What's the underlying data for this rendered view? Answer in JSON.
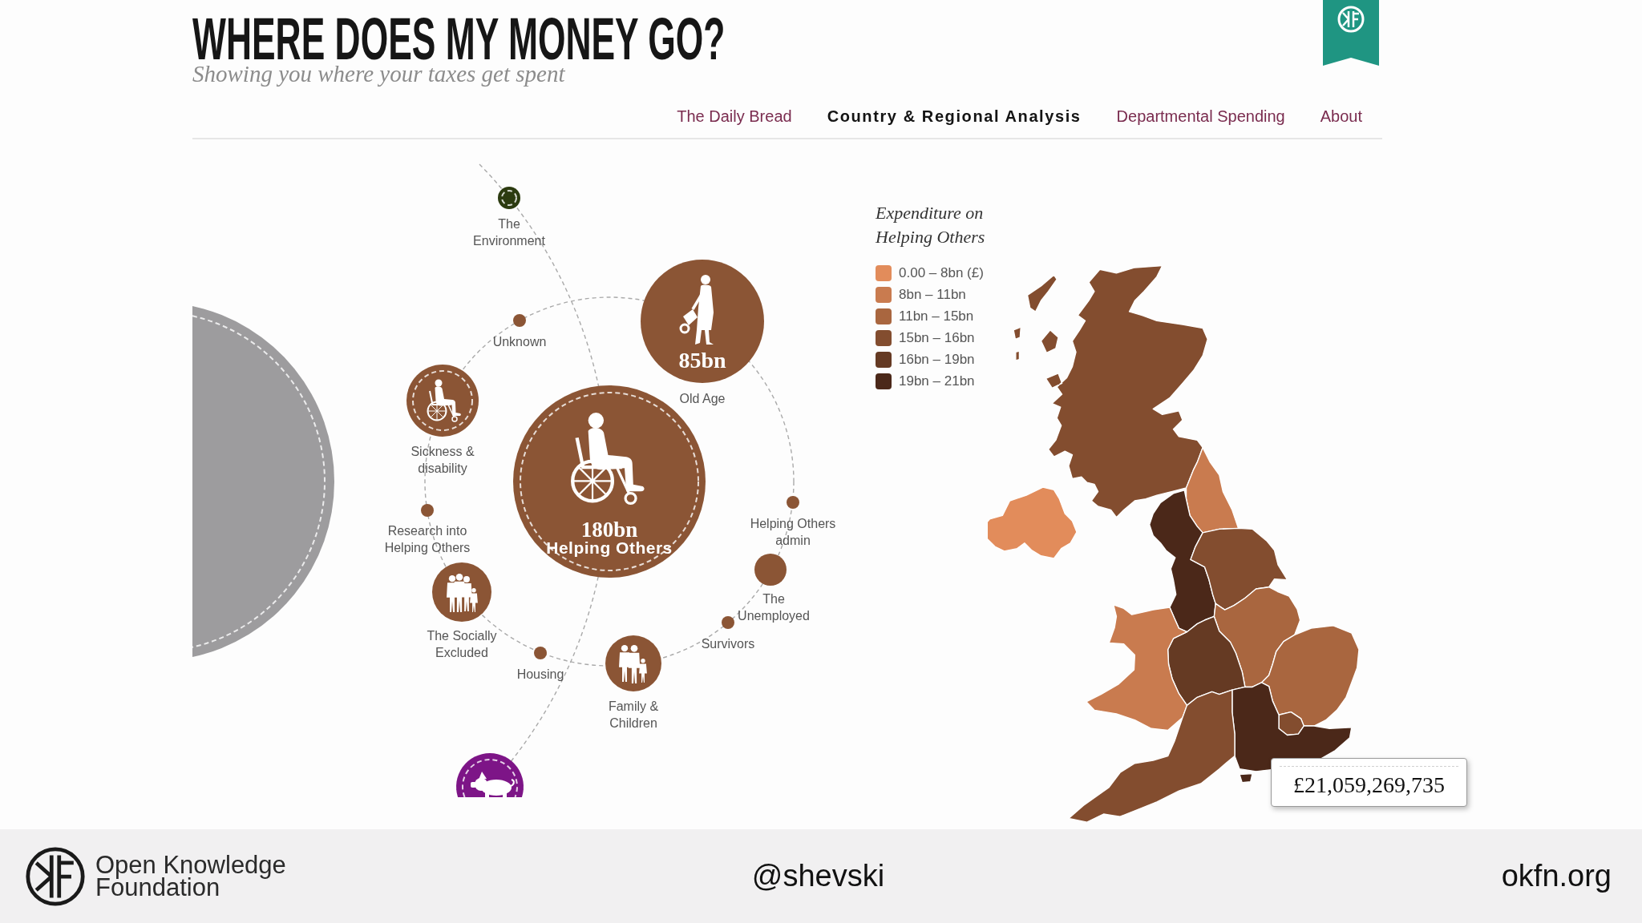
{
  "header": {
    "title": "WHERE DOES MY MONEY GO?",
    "subtitle": "Showing you where your taxes get spent"
  },
  "nav": [
    {
      "label": "The Daily Bread",
      "selected": false
    },
    {
      "label": "Country & Regional Analysis",
      "selected": true
    },
    {
      "label": "Departmental Spending",
      "selected": false
    },
    {
      "label": "About",
      "selected": false
    }
  ],
  "diagram": {
    "hub": {
      "amount": "180bn",
      "label": "Helping Others",
      "color": "#8b5535"
    },
    "nodes": [
      {
        "label": "The Environment",
        "kind": "ringed",
        "color": "#2c3b10"
      },
      {
        "label": "Old Age",
        "amount": "85bn",
        "kind": "bubble",
        "color": "#8b5535"
      },
      {
        "label": "Unknown",
        "kind": "dot",
        "color": "#8b5535"
      },
      {
        "label": "Sickness & disability",
        "kind": "ringed",
        "color": "#8b5535"
      },
      {
        "label": "Research into Helping Others",
        "kind": "dot",
        "color": "#8b5535"
      },
      {
        "label": "The Socially Excluded",
        "kind": "bubble",
        "color": "#8b5535"
      },
      {
        "label": "Housing",
        "kind": "dot",
        "color": "#8b5535"
      },
      {
        "label": "Family & Children",
        "kind": "bubble",
        "color": "#8b5535"
      },
      {
        "label": "Survivors",
        "kind": "dot",
        "color": "#8b5535"
      },
      {
        "label": "Helping Others admin",
        "kind": "dot",
        "color": "#8b5535"
      },
      {
        "label": "The Unemployed",
        "kind": "bubble",
        "color": "#8b5535"
      },
      {
        "kind": "ringed",
        "color": "#9d9c9e"
      },
      {
        "kind": "ringed",
        "color": "#7d1587"
      }
    ]
  },
  "legend": {
    "title": "Expenditure on Helping Others",
    "items": [
      {
        "label": "0.00 – 8bn (£)",
        "color": "#e28c5b"
      },
      {
        "label": "8bn – 11bn",
        "color": "#c97b4f"
      },
      {
        "label": "11bn – 15bn",
        "color": "#a9663f"
      },
      {
        "label": "15bn – 16bn",
        "color": "#834d2f"
      },
      {
        "label": "16bn – 19bn",
        "color": "#653a23"
      },
      {
        "label": "19bn – 21bn",
        "color": "#4b2819"
      }
    ]
  },
  "map": {
    "regions": [
      {
        "color": "#834d2f"
      },
      {
        "color": "#e28c5b"
      },
      {
        "color": "#c97b4f"
      },
      {
        "color": "#4b2819"
      },
      {
        "color": "#834d2f"
      },
      {
        "color": "#a9663f"
      },
      {
        "color": "#653a23"
      },
      {
        "color": "#c97b4f"
      },
      {
        "color": "#a9663f"
      },
      {
        "color": "#834d2f"
      },
      {
        "color": "#4b2819"
      },
      {
        "color": "#834d2f"
      }
    ],
    "tooltip": "£21,059,269,735"
  },
  "footer": {
    "organisation": "Open Knowledge Foundation",
    "handle": "@shevski",
    "website": "okfn.org"
  }
}
